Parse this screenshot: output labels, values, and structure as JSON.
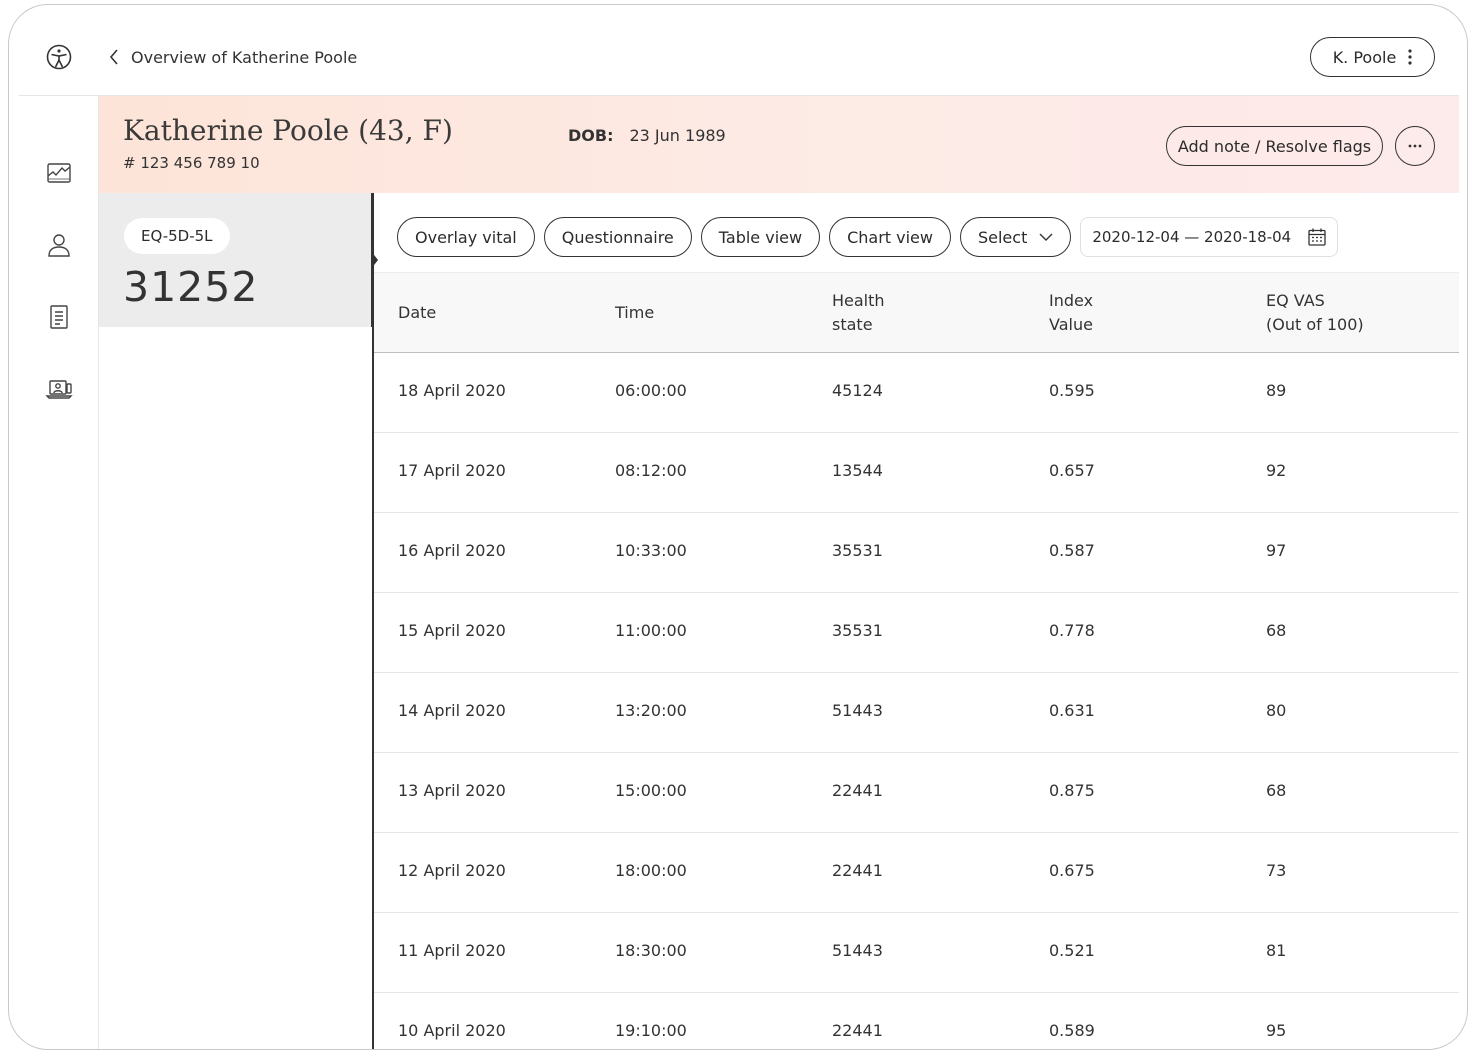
{
  "topbar": {
    "back_label": "Overview of Katherine Poole",
    "user_label": "K. Poole"
  },
  "icons": {
    "logo": "accessibility-logo-icon",
    "back": "chevron-left-icon",
    "user_menu": "kebab-vertical-icon",
    "rail": [
      "chart-icon",
      "person-icon",
      "document-icon",
      "video-call-icon"
    ],
    "more": "ellipsis-horizontal-icon",
    "calendar": "calendar-icon"
  },
  "patient": {
    "name": "Katherine Poole (43, F)",
    "id": "# 123 456 789 10",
    "dob_label": "DOB:",
    "dob_value": "23 Jun 1989",
    "note_button": "Add note / Resolve flags"
  },
  "card": {
    "label": "EQ-5D-5L",
    "value": "31252"
  },
  "toolbar": {
    "overlay": "Overlay vital",
    "questionnaire": "Questionnaire",
    "table_view": "Table view",
    "chart_view": "Chart view",
    "select": "Select",
    "date_range": "2020-12-04 — 2020-18-04"
  },
  "table": {
    "headers": {
      "date": "Date",
      "time": "Time",
      "health_1": "Health",
      "health_2": "state",
      "index_1": "Index",
      "index_2": "Value",
      "vas_1": "EQ VAS",
      "vas_2": "(Out of 100)"
    },
    "rows": [
      {
        "date": "18 April 2020",
        "time": "06:00:00",
        "health": "45124",
        "index": "0.595",
        "vas": "89"
      },
      {
        "date": "17 April 2020",
        "time": "08:12:00",
        "health": "13544",
        "index": "0.657",
        "vas": "92"
      },
      {
        "date": "16 April 2020",
        "time": "10:33:00",
        "health": "35531",
        "index": "0.587",
        "vas": "97"
      },
      {
        "date": "15 April 2020",
        "time": "11:00:00",
        "health": "35531",
        "index": "0.778",
        "vas": "68"
      },
      {
        "date": "14 April 2020",
        "time": "13:20:00",
        "health": "51443",
        "index": "0.631",
        "vas": "80"
      },
      {
        "date": "13 April 2020",
        "time": "15:00:00",
        "health": "22441",
        "index": "0.875",
        "vas": "68"
      },
      {
        "date": "12 April 2020",
        "time": "18:00:00",
        "health": "22441",
        "index": "0.675",
        "vas": "73"
      },
      {
        "date": "11 April 2020",
        "time": "18:30:00",
        "health": "51443",
        "index": "0.521",
        "vas": "81"
      },
      {
        "date": "10 April 2020",
        "time": "19:10:00",
        "health": "22441",
        "index": "0.589",
        "vas": "95"
      }
    ]
  },
  "colors": {
    "header_gradient_start": "#fde4d8",
    "header_gradient_end": "#fdeaea",
    "card_bg": "#ececec",
    "text": "#333333"
  }
}
